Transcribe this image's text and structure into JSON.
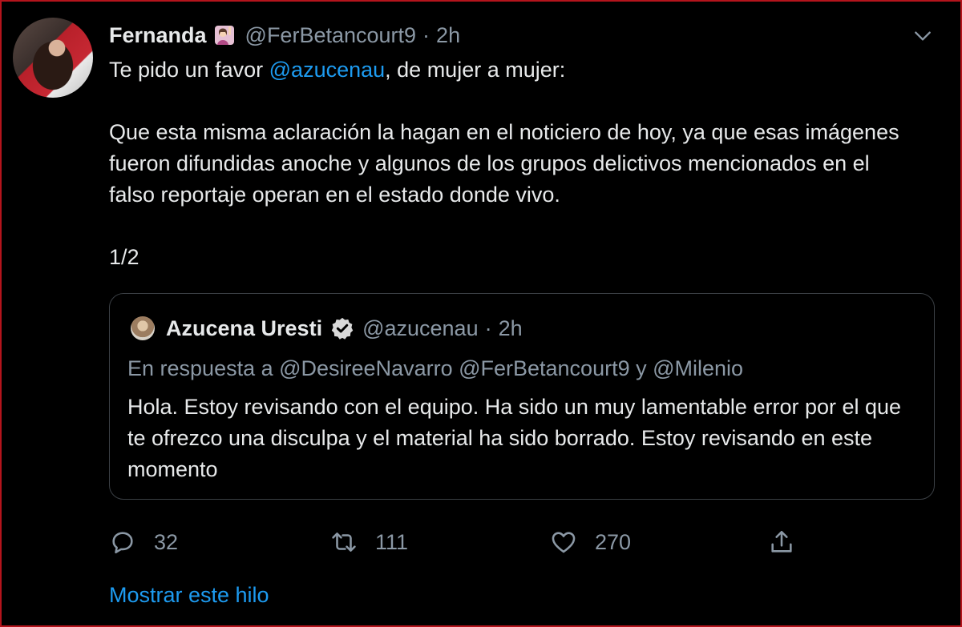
{
  "tweet": {
    "author_name": "Fernanda",
    "author_handle": "@FerBetancourt9",
    "separator": "·",
    "time": "2h",
    "text_before_mention": "Te pido un favor ",
    "mention": "@azucenau",
    "text_after_mention": ", de mujer a mujer:",
    "paragraph2": "Que esta misma aclaración la hagan en el noticiero de hoy, ya que esas imágenes fueron difundidas anoche y algunos de los grupos delictivos mencionados en el falso reportaje operan en el estado donde vivo.",
    "paragraph3": "1/2"
  },
  "quote": {
    "author_name": "Azucena Uresti",
    "author_handle": "@azucenau",
    "separator": "·",
    "time": "2h",
    "reply_to": "En respuesta a @DesireeNavarro @FerBetancourt9 y @Milenio",
    "text": "Hola. Estoy revisando con el equipo. Ha sido un muy lamentable error por el que te ofrezco una disculpa y el material ha sido borrado. Estoy revisando en este momento"
  },
  "actions": {
    "reply_count": "32",
    "retweet_count": "111",
    "like_count": "270"
  },
  "show_thread_label": "Mostrar este hilo",
  "icons": [
    "chevron-down-icon",
    "reply-icon",
    "retweet-icon",
    "like-icon",
    "share-icon",
    "verified-badge-icon",
    "woman-raising-hand-emoji-icon"
  ],
  "colors": {
    "background": "#000000",
    "accent": "#1d9bf0",
    "muted": "#8b98a5",
    "border": "#b4141c"
  }
}
